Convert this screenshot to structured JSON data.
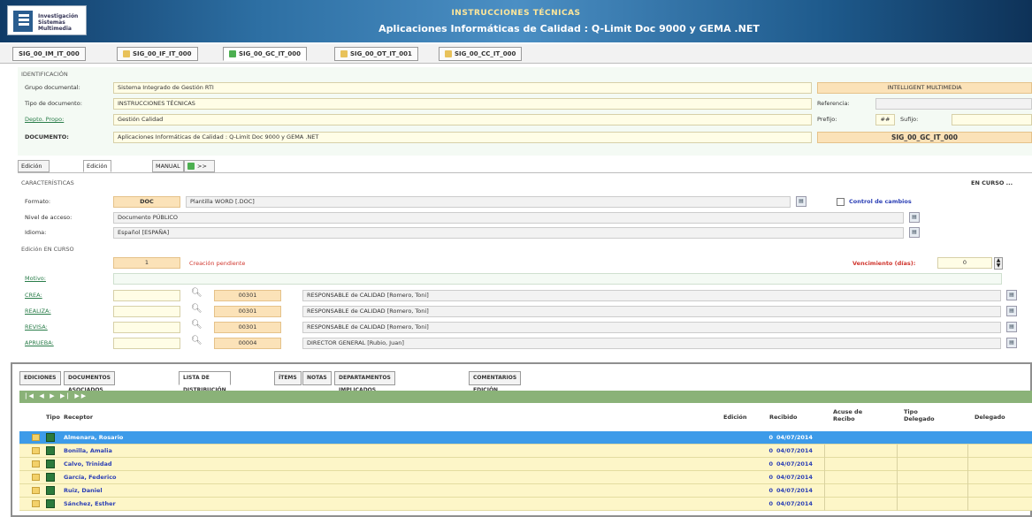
{
  "header": {
    "logo_text_1": "Investigación",
    "logo_text_2": "Sistemas",
    "logo_text_3": "Multimedia",
    "title": "INSTRUCCIONES TÉCNICAS",
    "subtitle": "Aplicaciones Informáticas de Calidad : Q-Limit Doc 9000 y GEMA .NET"
  },
  "doc_tabs": [
    "SIG_00_IM_IT_000",
    "SIG_00_IF_IT_000",
    "SIG_00_GC_IT_000",
    "SIG_00_OT_IT_001",
    "SIG_00_CC_IT_000"
  ],
  "identification": {
    "section": "IDENTIFICACIÓN",
    "grupo_label": "Grupo documental:",
    "grupo_value": "Sistema Integrado de Gestión RTI",
    "tipo_label": "Tipo de documento:",
    "tipo_value": "INSTRUCCIONES TÉCNICAS",
    "depto_label": "Depto. Propo:",
    "depto_value": "Gestión Calidad",
    "documento_label": "DOCUMENTO:",
    "documento_value": "Aplicaciones Informáticas de Calidad : Q-Limit Doc 9000 y GEMA .NET",
    "company": "INTELLIGENT MULTIMEDIA",
    "referencia_label": "Referencia:",
    "prefijo_label": "Prefijo:",
    "prefijo_value": "##",
    "sufijo_label": "Sufijo:",
    "code": "SIG_00_GC_IT_000"
  },
  "edition_tabs": [
    "Edición VIGENTE",
    "Edición EN CURSO",
    "MANUAL",
    ">> CREAR NUEVA EDICIÓN >>"
  ],
  "characteristics": {
    "section": "CARACTERÍSTICAS",
    "en_curso": "EN CURSO ...",
    "formato_label": "Formato:",
    "formato_code": "DOC",
    "formato_value": "Plantilla WORD [.DOC]",
    "control_label": "Control de cambios",
    "nivel_label": "Nivel de acceso:",
    "nivel_value": "Documento PÚBLICO",
    "idioma_label": "Idioma:",
    "idioma_value": "Español [ESPAÑA]",
    "edicion_label": "Edición EN CURSO",
    "edicion_num": "1",
    "edicion_status": "Creación pendiente",
    "vencimiento_label": "Vencimiento (días):",
    "vencimiento_value": "0",
    "motivo_label": "Motivo:",
    "roles": [
      {
        "label": "CREA:",
        "code": "00301",
        "value": "RESPONSABLE de CALIDAD [Romero, Toni]"
      },
      {
        "label": "REALIZA:",
        "code": "00301",
        "value": "RESPONSABLE de CALIDAD [Romero, Toni]"
      },
      {
        "label": "REVISA:",
        "code": "00301",
        "value": "RESPONSABLE de CALIDAD [Romero, Toni]"
      },
      {
        "label": "APRUEBA:",
        "code": "00004",
        "value": "DIRECTOR GENERAL [Rubio, Juan]"
      }
    ]
  },
  "bottom_tabs": [
    "EDICIONES",
    "DOCUMENTOS ASOCIADOS",
    "LISTA DE DISTRIBUCIÓN",
    "ÍTEMS",
    "NOTAS",
    "DEPARTAMENTOS IMPLICADOS",
    "COMENTARIOS EDICIÓN"
  ],
  "grid": {
    "nav": "|◀ ◀ ▶ ▶| ▶▶",
    "columns": {
      "tipo": "Tipo",
      "receptor": "Receptor",
      "edicion": "Edición",
      "recibido": "Recibido",
      "acuse": "Acuse de Recibo",
      "tipo_delegado": "Tipo Delegado",
      "delegado": "Delegado"
    },
    "rows": [
      {
        "name": "Almenara, Rosario",
        "edicion": "0",
        "recibido": "04/07/2014"
      },
      {
        "name": "Bonilla, Amalia",
        "edicion": "0",
        "recibido": "04/07/2014"
      },
      {
        "name": "Calvo, Trinidad",
        "edicion": "0",
        "recibido": "04/07/2014"
      },
      {
        "name": "García, Federico",
        "edicion": "0",
        "recibido": "04/07/2014"
      },
      {
        "name": "Ruiz, Daniel",
        "edicion": "0",
        "recibido": "04/07/2014"
      },
      {
        "name": "Sánchez, Esther",
        "edicion": "0",
        "recibido": "04/07/2014"
      }
    ]
  }
}
